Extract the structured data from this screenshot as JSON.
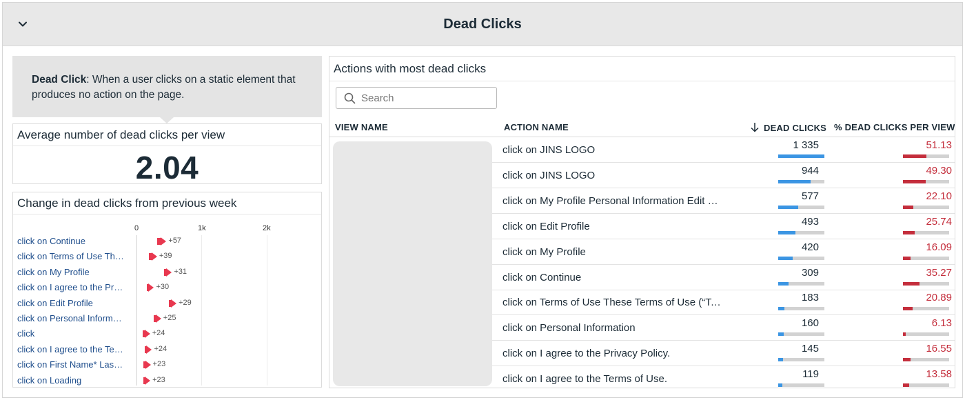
{
  "header": {
    "title": "Dead Clicks",
    "collapse_icon": "chevron-down-icon"
  },
  "info": {
    "term": "Dead Click",
    "definition": ": When a user clicks on a static element that produces no action on the page."
  },
  "average": {
    "title": "Average number of dead clicks per view",
    "value": "2.04"
  },
  "change": {
    "title": "Change in dead clicks from previous week",
    "axis": [
      "0",
      "1k",
      "2k"
    ],
    "rows": [
      {
        "label": "click on Continue",
        "delta": "+57",
        "value": 309
      },
      {
        "label": "click on Terms of Use These Terms of Use",
        "delta": "+39",
        "value": 183
      },
      {
        "label": "click on My Profile",
        "delta": "+31",
        "value": 420
      },
      {
        "label": "click on I agree to the Privacy Policy.",
        "delta": "+30",
        "value": 145
      },
      {
        "label": "click on Edit Profile",
        "delta": "+29",
        "value": 493
      },
      {
        "label": "click on Personal Information",
        "delta": "+25",
        "value": 260
      },
      {
        "label": "click",
        "delta": "+24",
        "value": 90
      },
      {
        "label": "click on I agree to the Terms of Use.",
        "delta": "+24",
        "value": 119
      },
      {
        "label": "click on First Name* Last Name*",
        "delta": "+23",
        "value": 100
      },
      {
        "label": "click on Loading",
        "delta": "+23",
        "value": 95
      }
    ]
  },
  "actions": {
    "title": "Actions with most dead clicks",
    "search_placeholder": "Search",
    "columns": {
      "view": "VIEW NAME",
      "action": "ACTION NAME",
      "dead": "DEAD CLICKS",
      "pct": "% DEAD CLICKS PER VIEW"
    },
    "colors": {
      "dead_bar": "#3b95e3",
      "pct_bar": "#c42e3c"
    },
    "rows": [
      {
        "action": "click on JINS LOGO",
        "dead": "1 335",
        "dead_frac": 1.0,
        "pct": "51.13",
        "pct_frac": 0.5113
      },
      {
        "action": "click on JINS LOGO",
        "dead": "944",
        "dead_frac": 0.707,
        "pct": "49.30",
        "pct_frac": 0.493
      },
      {
        "action": "click on My Profile Personal Information Edit Profile",
        "dead": "577",
        "dead_frac": 0.432,
        "pct": "22.10",
        "pct_frac": 0.221
      },
      {
        "action": "click on Edit Profile",
        "dead": "493",
        "dead_frac": 0.369,
        "pct": "25.74",
        "pct_frac": 0.2574
      },
      {
        "action": "click on My Profile",
        "dead": "420",
        "dead_frac": 0.315,
        "pct": "16.09",
        "pct_frac": 0.1609
      },
      {
        "action": "click on Continue",
        "dead": "309",
        "dead_frac": 0.231,
        "pct": "35.27",
        "pct_frac": 0.3527
      },
      {
        "action": "click on Terms of Use These Terms of Use (“Terms”)",
        "dead": "183",
        "dead_frac": 0.137,
        "pct": "20.89",
        "pct_frac": 0.2089
      },
      {
        "action": "click on Personal Information",
        "dead": "160",
        "dead_frac": 0.12,
        "pct": "6.13",
        "pct_frac": 0.0613
      },
      {
        "action": "click on I agree to the Privacy Policy.",
        "dead": "145",
        "dead_frac": 0.109,
        "pct": "16.55",
        "pct_frac": 0.1655
      },
      {
        "action": "click on I agree to the Terms of Use.",
        "dead": "119",
        "dead_frac": 0.089,
        "pct": "13.58",
        "pct_frac": 0.1358
      }
    ]
  }
}
